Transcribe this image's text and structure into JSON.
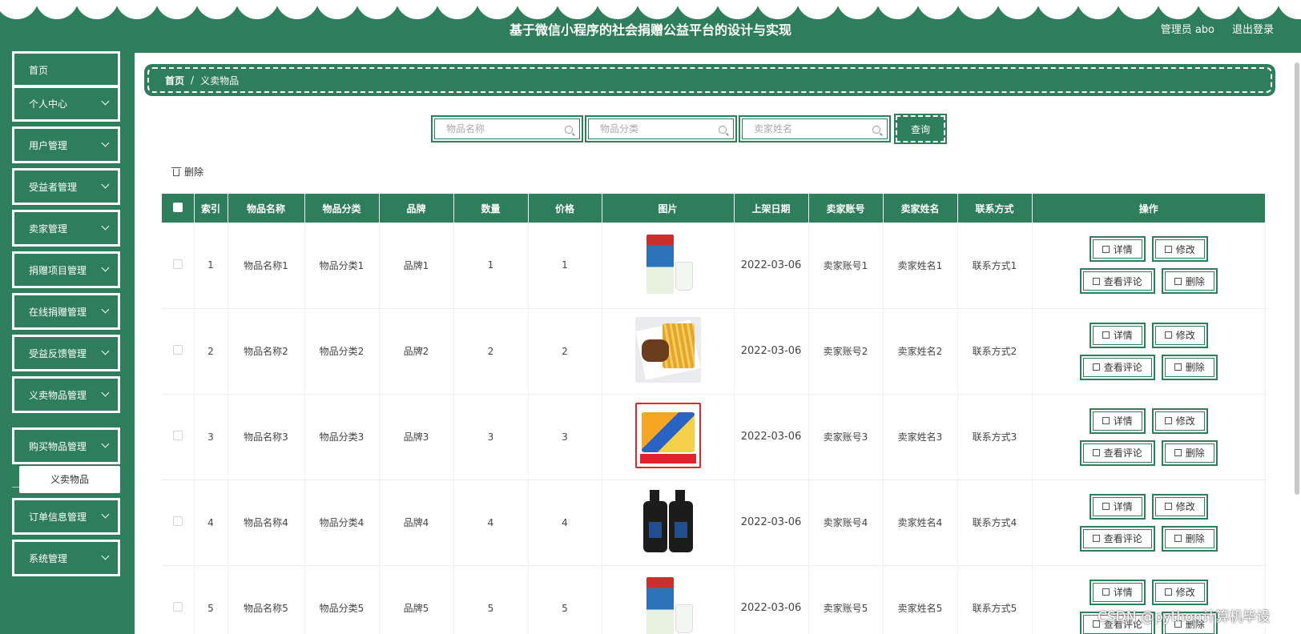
{
  "header": {
    "title": "基于微信小程序的社会捐赠公益平台的设计与实现",
    "user": "管理员 abo",
    "logout": "退出登录"
  },
  "sidebar": {
    "items": [
      {
        "label": "首页",
        "has_chevron": false
      },
      {
        "label": "个人中心",
        "has_chevron": true
      },
      {
        "label": "用户管理",
        "has_chevron": true
      },
      {
        "label": "受益者管理",
        "has_chevron": true
      },
      {
        "label": "卖家管理",
        "has_chevron": true
      },
      {
        "label": "捐赠项目管理",
        "has_chevron": true
      },
      {
        "label": "在线捐赠管理",
        "has_chevron": true
      },
      {
        "label": "受益反馈管理",
        "has_chevron": true
      },
      {
        "label": "义卖物品管理",
        "has_chevron": true
      },
      {
        "label": "购买物品管理",
        "has_chevron": true
      },
      {
        "label": "订单信息管理",
        "has_chevron": true
      },
      {
        "label": "系统管理",
        "has_chevron": true
      }
    ],
    "submenu_label": "义卖物品"
  },
  "breadcrumb": {
    "home": "首页",
    "separator": "/",
    "current": "义卖物品"
  },
  "search": {
    "item_name_placeholder": "物品名称",
    "category_placeholder": "物品分类",
    "seller_name_placeholder": "卖家姓名",
    "query_label": "查询"
  },
  "toolbar": {
    "delete_label": "删除"
  },
  "table": {
    "columns": [
      "索引",
      "物品名称",
      "物品分类",
      "品牌",
      "数量",
      "价格",
      "图片",
      "上架日期",
      "卖家账号",
      "卖家姓名",
      "联系方式",
      "操作"
    ],
    "rows": [
      {
        "index": "1",
        "name": "物品名称1",
        "category": "物品分类1",
        "brand": "品牌1",
        "quantity": "1",
        "price": "1",
        "image": "milk-carton-image",
        "date": "2022-03-06",
        "seller_account": "卖家账号1",
        "seller_name": "卖家姓名1",
        "contact": "联系方式1"
      },
      {
        "index": "2",
        "name": "物品名称2",
        "category": "物品分类2",
        "brand": "品牌2",
        "quantity": "2",
        "price": "2",
        "image": "burger-fries-image",
        "date": "2022-03-06",
        "seller_account": "卖家账号2",
        "seller_name": "卖家姓名2",
        "contact": "联系方式2"
      },
      {
        "index": "3",
        "name": "物品名称3",
        "category": "物品分类3",
        "brand": "品牌3",
        "quantity": "3",
        "price": "3",
        "image": "snack-box-image",
        "date": "2022-03-06",
        "seller_account": "卖家账号3",
        "seller_name": "卖家姓名3",
        "contact": "联系方式3"
      },
      {
        "index": "4",
        "name": "物品名称4",
        "category": "物品分类4",
        "brand": "品牌4",
        "quantity": "4",
        "price": "4",
        "image": "cleanser-bottles-image",
        "date": "2022-03-06",
        "seller_account": "卖家账号4",
        "seller_name": "卖家姓名4",
        "contact": "联系方式4"
      },
      {
        "index": "5",
        "name": "物品名称5",
        "category": "物品分类5",
        "brand": "品牌5",
        "quantity": "5",
        "price": "5",
        "image": "milk-carton-image",
        "date": "2022-03-06",
        "seller_account": "卖家账号5",
        "seller_name": "卖家姓名5",
        "contact": "联系方式5"
      }
    ],
    "actions": {
      "detail": "详情",
      "edit": "修改",
      "review": "查看评论",
      "delete": "删除"
    }
  },
  "watermark": "CSDN @python计算机毕设",
  "colors": {
    "primary": "#2e7d5b",
    "background": "#ffffff",
    "text": "#333333"
  }
}
